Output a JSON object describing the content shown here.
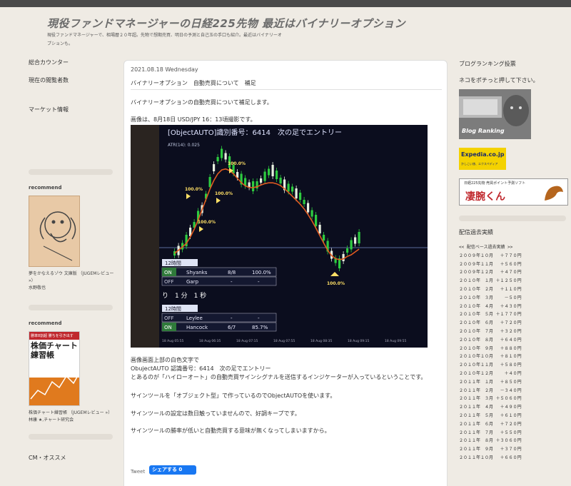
{
  "site": {
    "title": "現役ファンドマネージャーの日経225先物 最近はバイナリーオプション",
    "desc": "現役ファンドマネージャーで、相場暦２０年超。先物で想期売買、明日の予測と自己玉の手口も紹介。最近はバイナリーオプションも。"
  },
  "left": {
    "counter": "総合カウンター",
    "viewers": "現在の閲覧者数",
    "market": "マーケット情報",
    "recommend": "recommend",
    "book1": {
      "title": "夢をかなえるゾウ 文庫版 （JUGEMレビュー »）",
      "author": "水野敬也"
    },
    "book2": {
      "cover_line1": "勝率8割超 勝ちを引き出す",
      "cover_title": "株価チャート練習帳",
      "title": "株価チャート練習帳 （JUGEMレビュー »）",
      "author": "林康 ★,チャート研究会"
    },
    "cm": "CM・オススメ"
  },
  "post": {
    "date": "2021.08.18 Wednesday",
    "title": "バイナリーオプション　自動売買について　補足",
    "p1": "バイナリーオプションの自動売買について補足します。",
    "p2": "画像は、8月18日 USD/JPY 16：13頃撮影です。",
    "p3a": "画像画面上部の白色文字で",
    "p3b": "ObujectAUTO 認識番号：6414　次の足でエントリー",
    "p3c": "とあるのが「ハイローオート」の自動売買サインシグナルを送信するインジケーターが入っているということです。",
    "p4": "サインツールを「オブジェクト型」で作っているのでObjectAUTOを使います。",
    "p5": "サインツールの設定は数日触っていませんので、好調キープです。",
    "p6": "サインツールの勝率が低いと自動売買する意味が無くなってしまいますから。",
    "tweet": "Tweet",
    "fb": "シェアする 0"
  },
  "photo": {
    "header": "[ObjectAUTO]識別番号：6414　次の足でエントリー",
    "atr": "ATR(14): 0.025",
    "pct_labels": [
      "100.0%",
      "100.0%",
      "100.0%",
      "100.0%",
      "100.0%"
    ],
    "table1": {
      "time": "12時間",
      "r1": [
        "ON",
        "Shyanks",
        "8/8",
        "100.0%"
      ],
      "r2": [
        "OFF",
        "Garp",
        "-",
        "-"
      ]
    },
    "caption": "り　1 分　1 秒",
    "table2": {
      "time": "12時間",
      "r1": [
        "OFF",
        "Leylee",
        "-",
        "-"
      ],
      "r2": [
        "ON",
        "Hancock",
        "6/7",
        "85.7%"
      ]
    },
    "times": [
      "18 Aug 05:55",
      "18 Aug 06:35",
      "18 Aug 07:15",
      "18 Aug 07:55",
      "18 Aug 08:35",
      "18 Aug 09:15",
      "18 Aug 09:55"
    ]
  },
  "right": {
    "ranking": "ブログランキング投票",
    "ranking_sub": "ネコをポチっと押して下さい。",
    "blog_rank_label": "Blog Ranking",
    "expedia": "Expedia.co.jp",
    "expedia_sub": "かしこい旅、エクスペディア",
    "banner_top": "日経225先物 売買ポイント予測ソフト",
    "banner_main": "凄腕くん",
    "record_head": "配信過去実績",
    "record_title": "<< 配信ベース過去実績 >>",
    "records": [
      "２００９年１０月　 ＋７７０円",
      "２００９年１１月　 ＋５６０円",
      "２００９年１２月　 ＋４７０円",
      "２０１０年　１月 ＋１２５０円",
      "２０１０年　２月　 ＋１１０円",
      "２０１０年　３月　　 －５０円",
      "２０１０年　４月　 ＋４３０円",
      "２０１０年　５月 ＋１７７０円",
      "２０１０年　６月　 ＋７２０円",
      "２０１０年　７月　 ＋３２０円",
      "２０１０年　８月　 ＋６４０円",
      "２０１０年　９月　 ＋８８０円",
      "２０１０年１０月　 ＋８１０円",
      "２０１０年１１月　 ＋５８０円",
      "２０１０年１２月　　 ＋４０円",
      "２０１１年　１月　 ＋８５０円",
      "２０１１年　２月　 －３４０円",
      "２０１１年　３月 ＋５０６０円",
      "２０１１年　４月　 ＋４９０円",
      "２０１１年　５月　 ＋６１０円",
      "２０１１年　６月　 ＋７２０円",
      "２０１１年　７月　 ＋５５０円",
      "２０１１年　８月 ＋３０６０円",
      "２０１１年　９月　 ＋３７０円",
      "２０１１年１０月　 ＋６６０円"
    ]
  }
}
